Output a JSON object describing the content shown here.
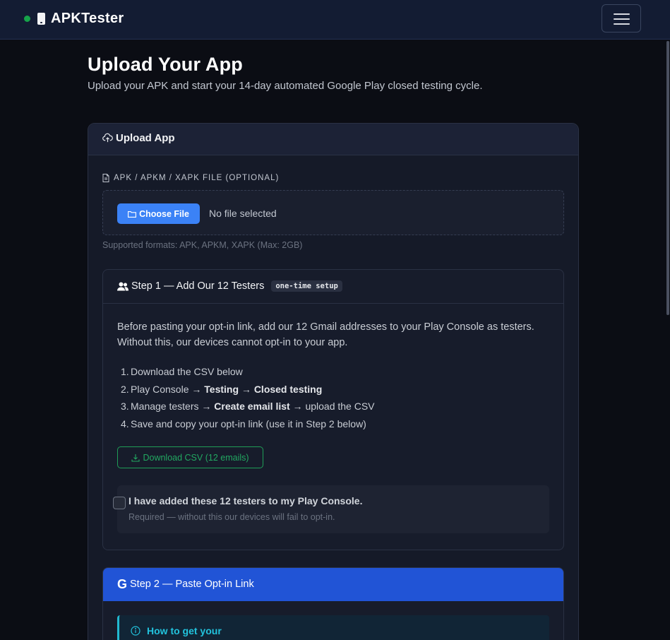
{
  "navbar": {
    "brand": "APKTester"
  },
  "page": {
    "title": "Upload Your App",
    "subtitle": "Upload your APK and start your 14-day automated Google Play closed testing cycle."
  },
  "upload_card": {
    "title": "Upload App",
    "file_label": "APK / APKM / XAPK FILE (OPTIONAL)",
    "choose_button": "Choose File",
    "no_file_text": "No file selected",
    "formats_hint": "Supported formats: APK, APKM, XAPK (Max: 2GB)"
  },
  "step1": {
    "title": "Step 1 — Add Our 12 Testers",
    "badge": "one-time setup",
    "intro": "Before pasting your opt-in link, add our 12 Gmail addresses to your Play Console as testers. Without this, our devices cannot opt-in to your app.",
    "steps": [
      {
        "num": "1.",
        "pre": "Download the CSV below",
        "b1": "",
        "mid": "",
        "b2": "",
        "post": ""
      },
      {
        "num": "2.",
        "pre": "Play Console → ",
        "b1": "Testing",
        "mid": " → ",
        "b2": "Closed testing",
        "post": ""
      },
      {
        "num": "3.",
        "pre": "Manage testers → ",
        "b1": "Create email list",
        "mid": " → upload the CSV",
        "b2": "",
        "post": ""
      },
      {
        "num": "4.",
        "pre": "Save and copy your opt-in link (use it in Step 2 below)",
        "b1": "",
        "mid": "",
        "b2": "",
        "post": ""
      }
    ],
    "download_button": "Download CSV (12 emails)",
    "confirm_title": "I have added these 12 testers to my Play Console.",
    "confirm_note": "Required — without this our devices will fail to opt-in.",
    "confirm_checked": false
  },
  "step2": {
    "icon_letter": "G",
    "title": "Step 2 — Paste Opt-in Link",
    "info_text": "How to get your"
  },
  "colors": {
    "navbar_bg": "#131c33",
    "accent_blue": "#3b82f6",
    "success_green": "#22a861",
    "step2_header": "#2154d6",
    "info_cyan": "#22c3dd"
  }
}
